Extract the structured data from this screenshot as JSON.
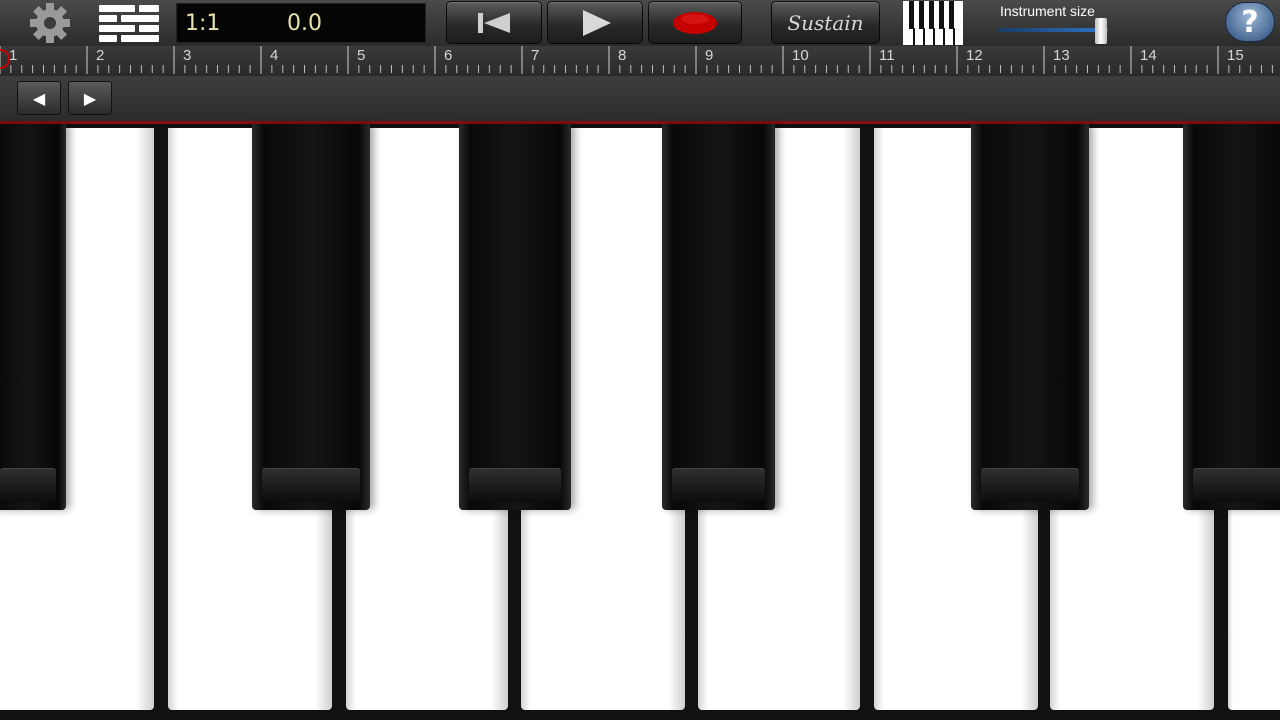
{
  "toolbar": {
    "settings_icon": "gear-icon",
    "menu_icon": "menu-icon",
    "lcd": {
      "position": "1:1",
      "time": "0.0"
    },
    "rewind_icon": "skip-back-icon",
    "play_icon": "play-icon",
    "record_icon": "record-icon",
    "sustain_label": "Sustain",
    "keyboard_icon": "keyboard-layout-icon",
    "instrument_size_label": "Instrument size",
    "instrument_size_value": 0.94,
    "help_label": "?"
  },
  "ruler": {
    "numbers": [
      "1",
      "2",
      "3",
      "4",
      "5",
      "6",
      "7",
      "8",
      "9",
      "10",
      "11",
      "12",
      "13",
      "14",
      "15"
    ]
  },
  "nav": {
    "prev_label": "◀",
    "next_label": "▶"
  },
  "keyboard": {
    "white_key_count": 8,
    "black_key_count": 6
  },
  "colors": {
    "accent_red": "#c40000",
    "slider_blue": "#2f76c9",
    "lcd_text": "#e7e3a8"
  }
}
